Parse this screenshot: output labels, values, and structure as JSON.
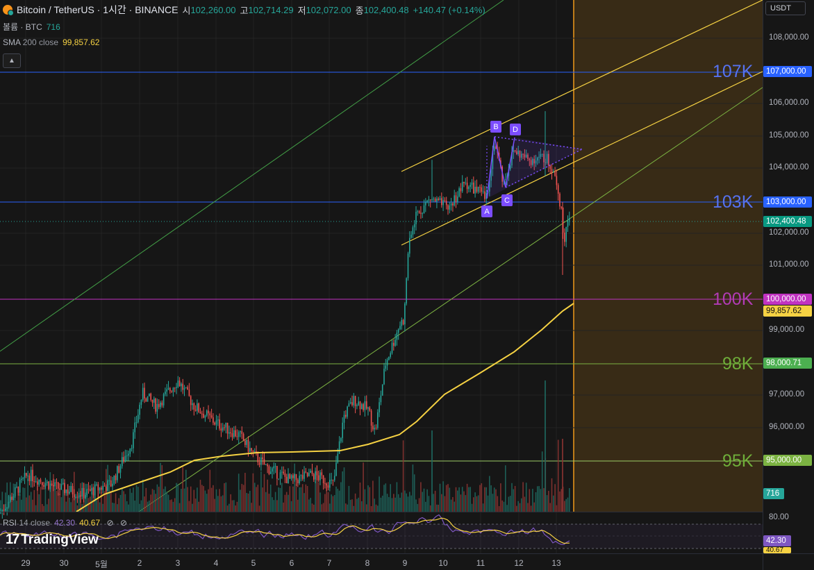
{
  "header": {
    "symbol_title": "Bitcoin / TetherUS · 1시간 · BINANCE",
    "open_label": "시",
    "open_value": "102,260.00",
    "high_label": "고",
    "high_value": "102,714.29",
    "low_label": "저",
    "low_value": "102,072.00",
    "close_label": "종",
    "close_value": "102,400.48",
    "change_value": "+140.47 (+0.14%)"
  },
  "volume_legend": {
    "label": "볼륨 · BTC",
    "value": "716"
  },
  "sma_legend": {
    "label": "SMA",
    "params": "200 close",
    "value": "99,857.62"
  },
  "rsi_legend": {
    "label": "RSI",
    "params": "14 close",
    "value1": "42.30",
    "value2": "40.67",
    "icons": [
      "eye-off-icon",
      "hidden-icon"
    ]
  },
  "currency_button": "USDT",
  "price_axis": {
    "ticks": [
      "108,000.00",
      "106,000.00",
      "105,000.00",
      "104,000.00",
      "102,000.00",
      "101,000.00",
      "99,000.00",
      "97,000.00",
      "96,000.00"
    ],
    "labels": {
      "l107": "107,000.00",
      "l103": "103,000.00",
      "current": "102,400.48",
      "l100": "100,000.00",
      "sma": "99,857.62",
      "l98": "98,000.71",
      "l95": "95,000.00",
      "volume": "716"
    }
  },
  "rsi_axis": {
    "top": "80.00",
    "value1": "42.30",
    "value2": "40.67"
  },
  "level_text": {
    "k107": "107K",
    "k103": "103K",
    "k100": "100K",
    "k98": "98K",
    "k95": "95K"
  },
  "pattern_labels": {
    "a": "A",
    "b": "B",
    "c": "C",
    "d": "D"
  },
  "time_axis": [
    "29",
    "30",
    "5월",
    "2",
    "3",
    "4",
    "5",
    "6",
    "7",
    "8",
    "9",
    "10",
    "11",
    "12",
    "13"
  ],
  "brand": "TradingView",
  "colors": {
    "background": "#161616",
    "up": "#26a69a",
    "down": "#ef5350",
    "sma": "#f6d243",
    "level_blue": "#2962ff",
    "level_magenta": "#c133c1",
    "level_green": "#7cb342",
    "future_zone": "#3a2c16",
    "rsi": "#9575cd"
  }
}
